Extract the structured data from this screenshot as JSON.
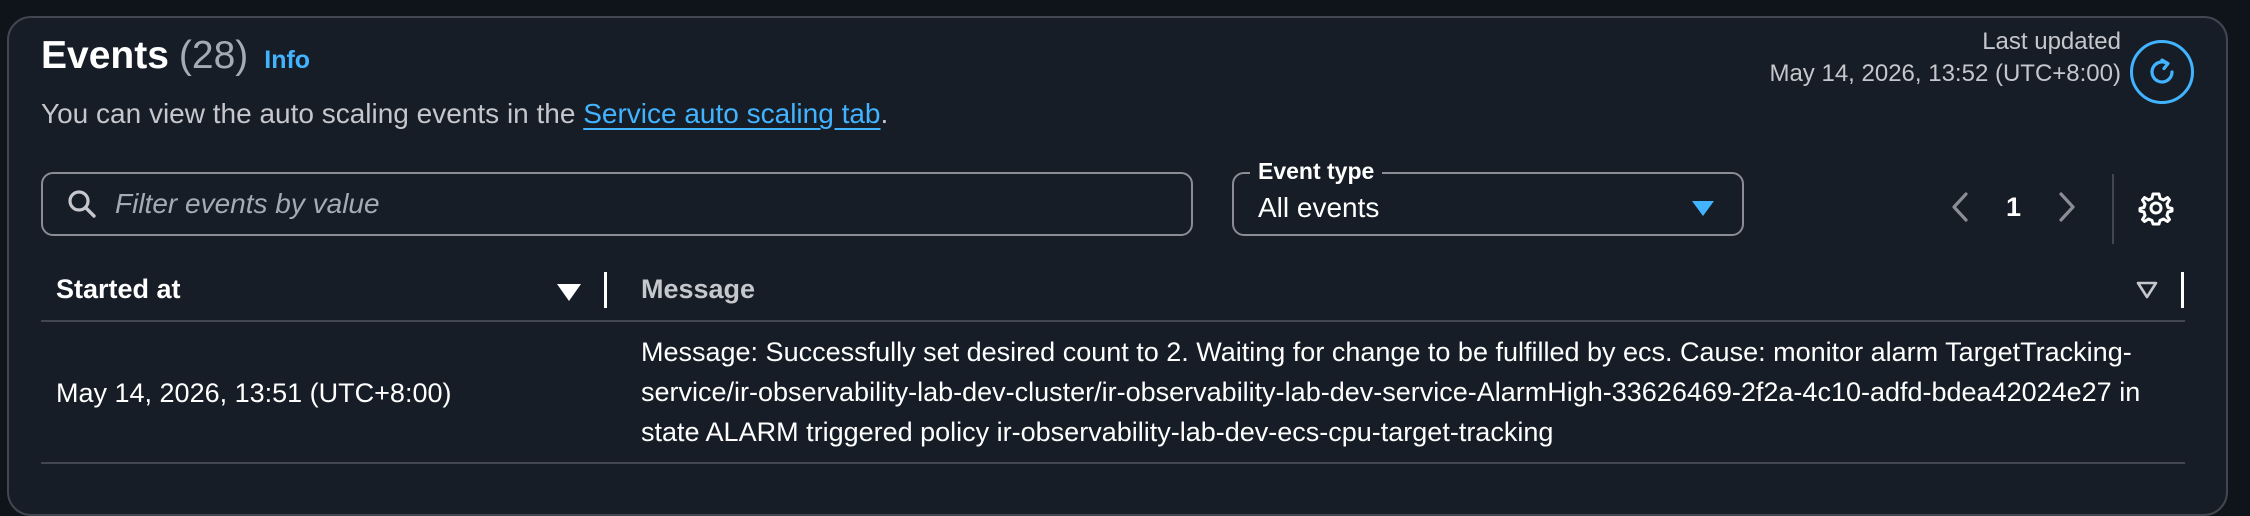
{
  "header": {
    "title": "Events",
    "count": "(28)",
    "info_label": "Info",
    "description_prefix": "You can view the auto scaling events in the ",
    "description_link": "Service auto scaling tab",
    "description_suffix": "."
  },
  "last_updated": {
    "label": "Last updated",
    "value": "May 14, 2026, 13:52 (UTC+8:00)"
  },
  "filter": {
    "placeholder": "Filter events by value"
  },
  "event_type": {
    "label": "Event type",
    "selected": "All events"
  },
  "pagination": {
    "current_page": "1"
  },
  "table": {
    "columns": [
      "Started at",
      "Message"
    ],
    "rows": [
      {
        "started_at": "May 14, 2026, 13:51 (UTC+8:00)",
        "message": "Message: Successfully set desired count to 2. Waiting for change to be fulfilled by ecs. Cause: monitor alarm TargetTracking-service/ir-observability-lab-dev-cluster/ir-observability-lab-dev-service-AlarmHigh-33626469-2f2a-4c10-adfd-bdea42024e27 in state ALARM triggered policy ir-observability-lab-dev-ecs-cpu-target-tracking"
      }
    ]
  },
  "colors": {
    "panel_bg": "#161d26",
    "page_bg": "#0f141a",
    "accent": "#42b4ff",
    "border": "#424650"
  }
}
